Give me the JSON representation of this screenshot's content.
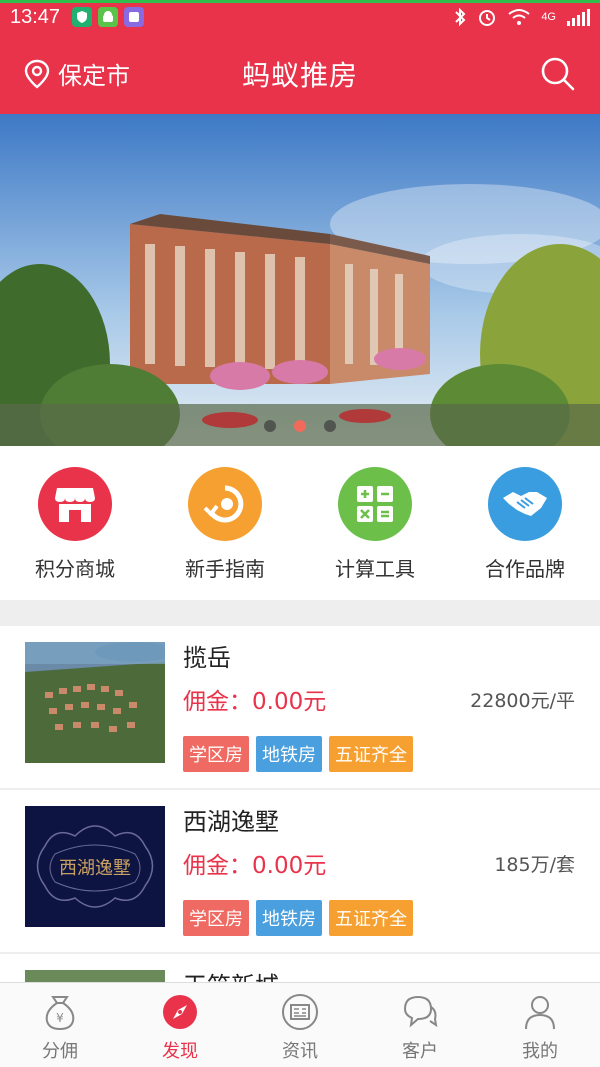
{
  "status_bar": {
    "time": "13:47",
    "network": "4G"
  },
  "header": {
    "city": "保定市",
    "title": "蚂蚁推房"
  },
  "banner": {
    "slides": 3,
    "active_index": 1
  },
  "quick_menu": [
    {
      "label": "积分商城",
      "icon": "store-icon",
      "color": "#e8334a"
    },
    {
      "label": "新手指南",
      "icon": "guide-icon",
      "color": "#f5a030"
    },
    {
      "label": "计算工具",
      "icon": "calculator-icon",
      "color": "#6cc04a"
    },
    {
      "label": "合作品牌",
      "icon": "handshake-icon",
      "color": "#3a9de0"
    }
  ],
  "listings": [
    {
      "name": "揽岳",
      "commission": "佣金：0.00元",
      "price": "22800元/平",
      "tags": [
        "学区房",
        "地铁房",
        "五证齐全"
      ]
    },
    {
      "name": "西湖逸墅",
      "commission": "佣金：0.00元",
      "price": "185万/套",
      "tags": [
        "学区房",
        "地铁房",
        "五证齐全"
      ],
      "logo_text": "西湖逸墅"
    },
    {
      "name": "天筑新城"
    }
  ],
  "tag_colors": {
    "学区房": "#ef6a62",
    "地铁房": "#4a9fdf",
    "五证齐全": "#f5a030"
  },
  "bottom_nav": [
    {
      "label": "分佣",
      "icon": "money-bag-icon"
    },
    {
      "label": "发现",
      "icon": "compass-icon",
      "active": true
    },
    {
      "label": "资讯",
      "icon": "news-icon"
    },
    {
      "label": "客户",
      "icon": "chat-icon"
    },
    {
      "label": "我的",
      "icon": "user-icon"
    }
  ],
  "colors": {
    "brand": "#e8334a"
  }
}
